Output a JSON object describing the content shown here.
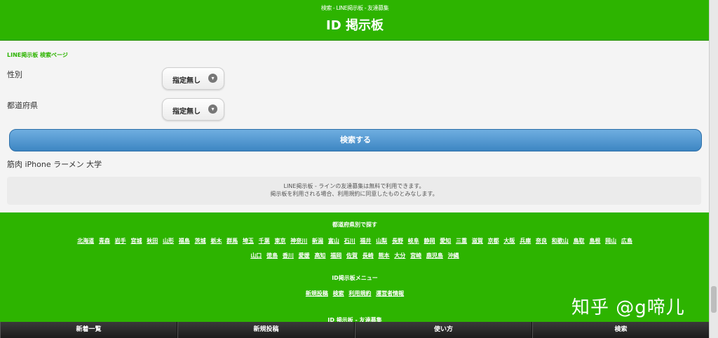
{
  "header": {
    "subtitle": "検索 - LINE掲示板 - 友達募集",
    "title": "ID 掲示板"
  },
  "breadcrumb": "LINE掲示板 検索ページ",
  "form": {
    "gender_label": "性別",
    "gender_value": "指定無し",
    "pref_label": "都道府県",
    "pref_value": "指定無し",
    "search_button": "検索する"
  },
  "tags": "筋肉 iPhone ラーメン 大学",
  "notice": {
    "line1": "LINE掲示板 - ラインの友達募集は無料で利用できます。",
    "line2": "掲示板を利用される場合、利用規約に同意したものとみなします。"
  },
  "footer": {
    "prefs_heading": "都道府県別で探す",
    "prefs_row1": [
      "北海道",
      "青森",
      "岩手",
      "宮城",
      "秋田",
      "山形",
      "福島",
      "茨城",
      "栃木",
      "群馬",
      "埼玉",
      "千葉",
      "東京",
      "神奈川",
      "新潟",
      "富山",
      "石川",
      "福井",
      "山梨",
      "長野",
      "岐阜",
      "静岡",
      "愛知",
      "三重",
      "滋賀",
      "京都",
      "大阪",
      "兵庫",
      "奈良",
      "和歌山",
      "鳥取",
      "島根",
      "岡山",
      "広島"
    ],
    "prefs_row2": [
      "山口",
      "徳島",
      "香川",
      "愛媛",
      "高知",
      "福岡",
      "佐賀",
      "長崎",
      "熊本",
      "大分",
      "宮崎",
      "鹿児島",
      "沖縄"
    ],
    "menu_heading": "ID掲示板メニュー",
    "menu": [
      "新規投稿",
      "検索",
      "利用規約",
      "運営者情報"
    ],
    "bottom_title": "ID 掲示板 - 友達募集"
  },
  "watermark": "知乎 @g啼儿",
  "tabbar": [
    "新着一覧",
    "新規投稿",
    "使い方",
    "検索"
  ]
}
